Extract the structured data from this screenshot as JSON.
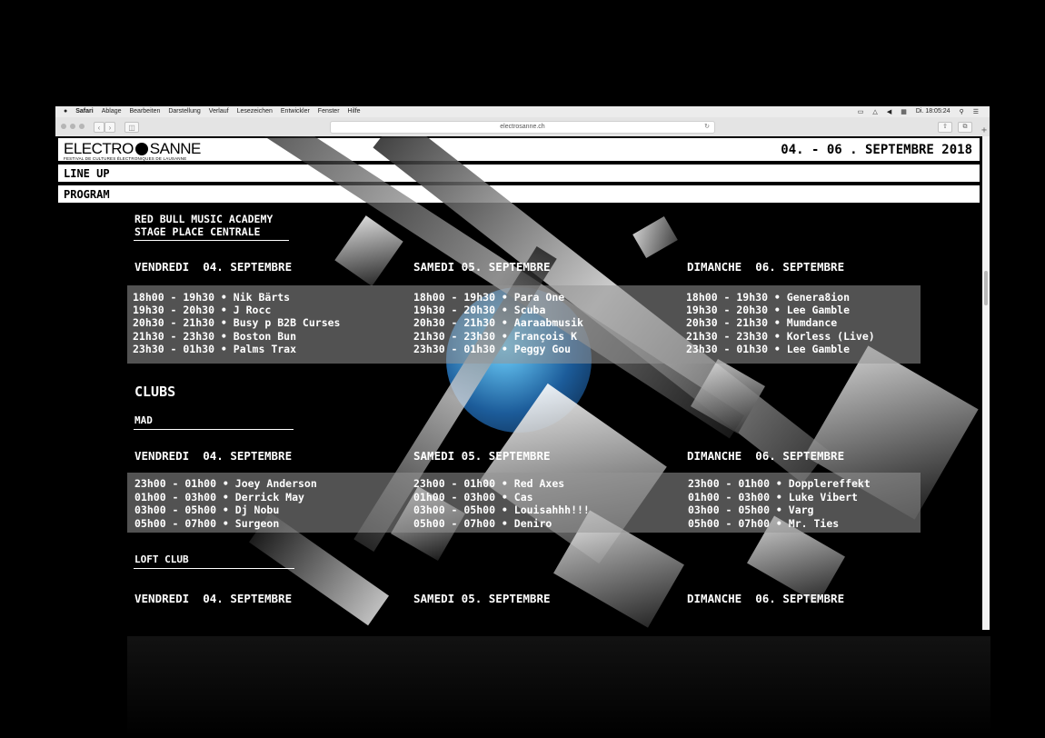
{
  "menubar": {
    "app": "Safari",
    "items": [
      "Ablage",
      "Bearbeiten",
      "Darstellung",
      "Verlauf",
      "Lesezeichen",
      "Entwickler",
      "Fenster",
      "Hilfe"
    ],
    "clock": "Di. 18:05:24"
  },
  "toolbar": {
    "url": "electrosanne.ch"
  },
  "header": {
    "logo_left": "ELECTRO",
    "logo_right": "SANNE",
    "logo_sub": "FESTIVAL DE CULTURES ÉLECTRONIQUES DE LAUSANNE",
    "dates": "04. - 06 . SEPTEMBRE 2018"
  },
  "nav": {
    "lineup": "LINE UP",
    "program": "PROGRAM"
  },
  "stage": {
    "line1": "RED BULL MUSIC ACADEMY",
    "line2": "STAGE PLACE CENTRALE"
  },
  "days": {
    "fri": "VENDREDI  04. SEPTEMBRE",
    "sat": "SAMEDI 05. SEPTEMBRE",
    "sun": "DIMANCHE  06. SEPTEMBRE"
  },
  "stage_schedule": {
    "fri": [
      "18h00 - 19h30 • Nik Bärts",
      "19h30 - 20h30 • J Rocc",
      "20h30 - 21h30 • Busy p B2B Curses",
      "21h30 - 23h30 • Boston Bun",
      "23h30 - 01h30 • Palms Trax"
    ],
    "sat": [
      "18h00 - 19h30 • Para One",
      "19h30 - 20h30 • Scuba",
      "20h30 - 21h30 • Aaraabmusik",
      "21h30 - 23h30 • François K",
      "23h30 - 01h30 • Peggy Gou"
    ],
    "sun": [
      "18h00 - 19h30 • Genera8ion",
      "19h30 - 20h30 • Lee Gamble",
      "20h30 - 21h30 • Mumdance",
      "21h30 - 23h30 • Korless (Live)",
      "23h30 - 01h30 • Lee Gamble"
    ]
  },
  "clubs": {
    "title": "CLUBS",
    "mad": "MAD",
    "loft": "LOFT CLUB"
  },
  "mad_schedule": {
    "fri": [
      "23h00 - 01h00 • Joey Anderson",
      "01h00 - 03h00 • Derrick May",
      "03h00 - 05h00 • Dj Nobu",
      "05h00 - 07h00 • Surgeon"
    ],
    "sat": [
      "23h00 - 01h00 • Red Axes",
      "01h00 - 03h00 • Cas",
      "03h00 - 05h00 • Louisahhh!!!",
      "05h00 - 07h00 • Deniro"
    ],
    "sun": [
      "23h00 - 01h00 • Dopplereffekt",
      "01h00 - 03h00 • Luke Vibert",
      "03h00 - 05h00 • Varg",
      "05h00 - 07h00 • Mr. Ties"
    ]
  }
}
